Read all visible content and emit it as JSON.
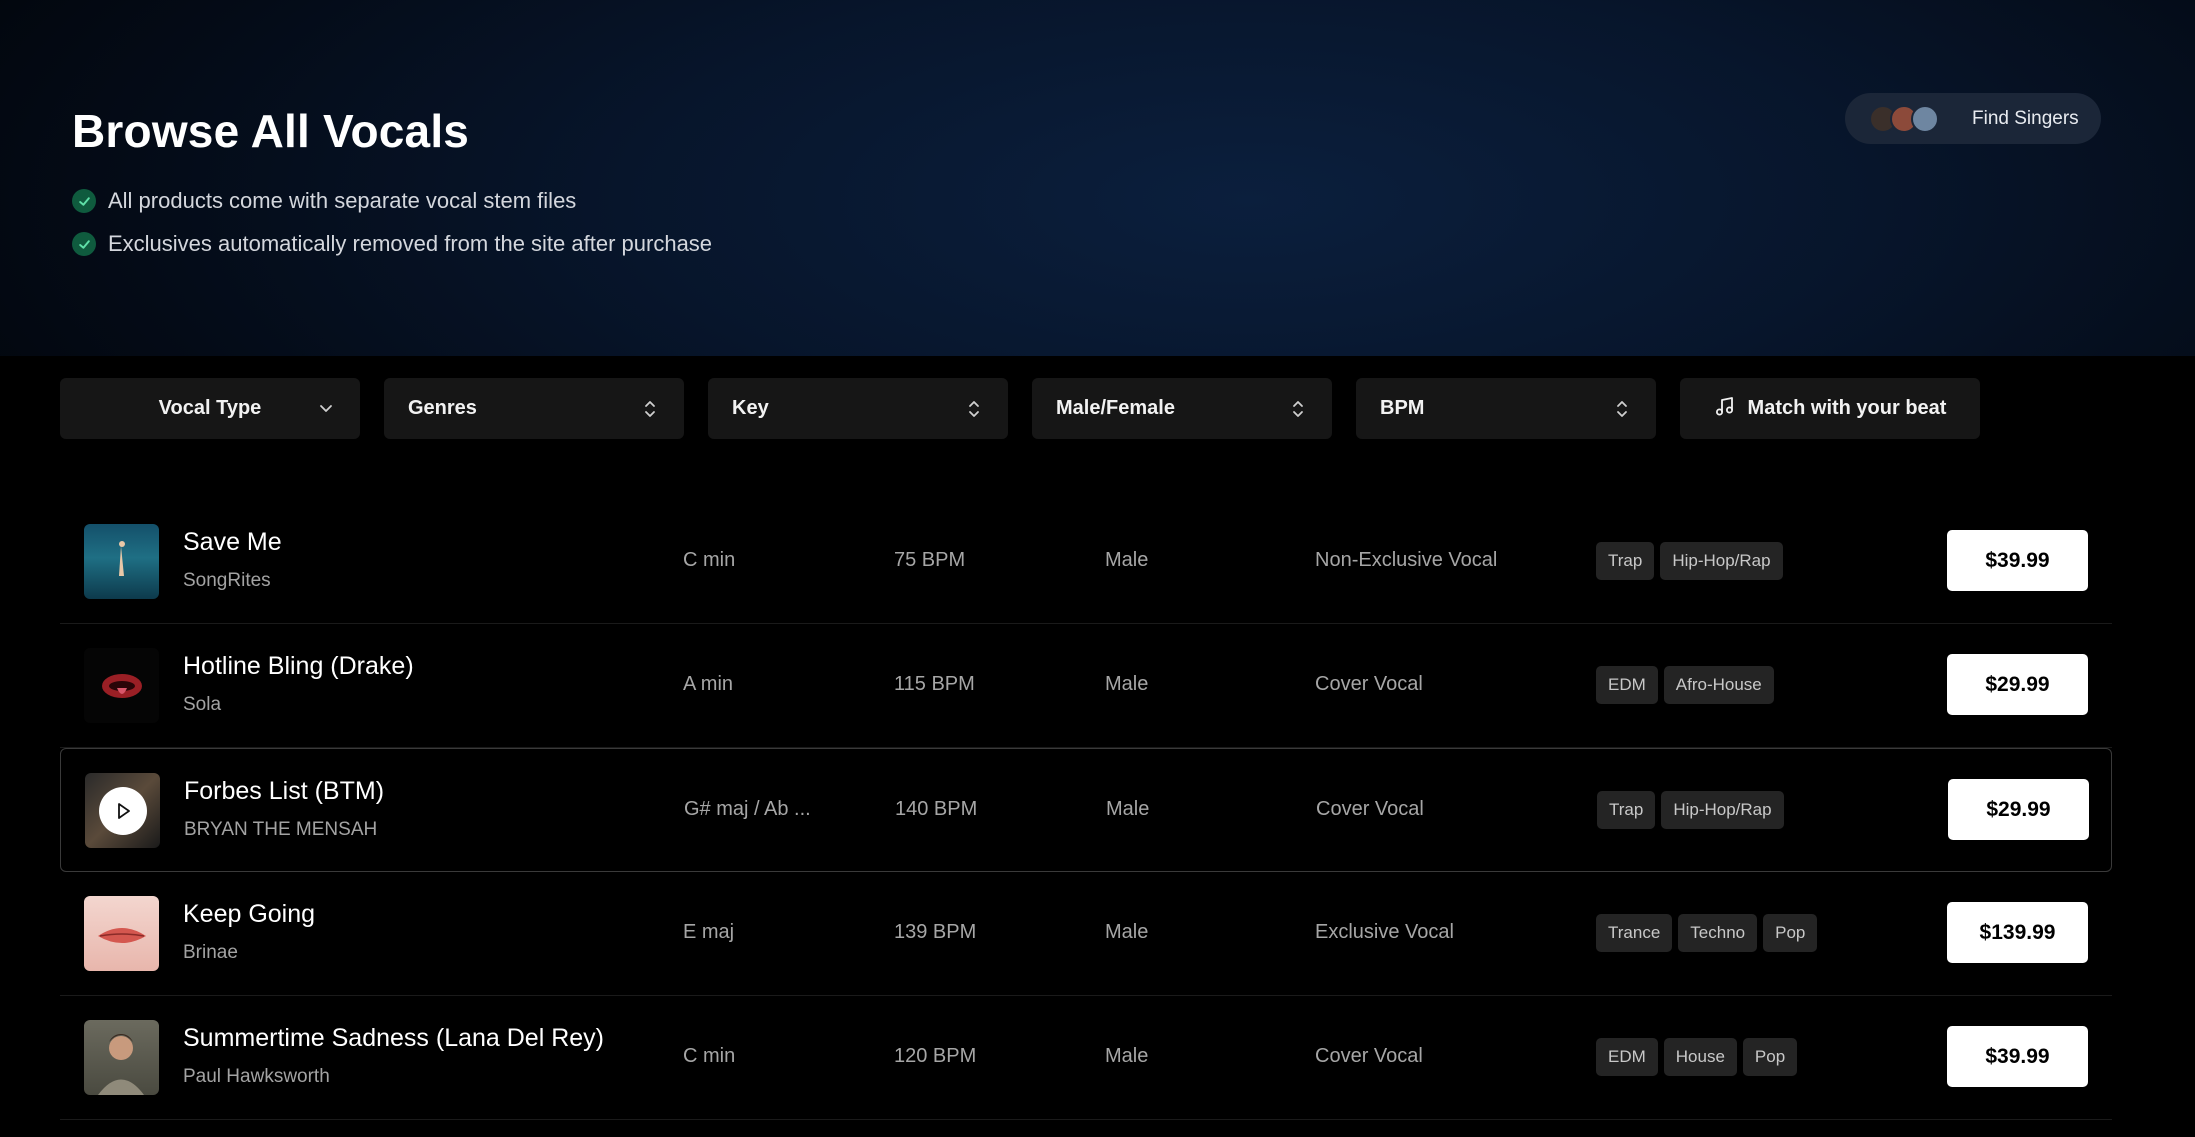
{
  "hero": {
    "title": "Browse All Vocals",
    "features": [
      "All products come with separate vocal stem files",
      "Exclusives automatically removed from the site after purchase"
    ],
    "find_singers_label": "Find Singers"
  },
  "filters": {
    "vocal_type": "Vocal Type",
    "genres": "Genres",
    "key": "Key",
    "gender": "Male/Female",
    "bpm": "BPM",
    "match": "Match with your beat"
  },
  "tracks": [
    {
      "title": "Save Me",
      "artist": "SongRites",
      "key": "C min",
      "bpm": "75 BPM",
      "gender": "Male",
      "type": "Non-Exclusive Vocal",
      "tags": [
        "Trap",
        "Hip-Hop/Rap"
      ],
      "price": "$39.99"
    },
    {
      "title": "Hotline Bling (Drake)",
      "artist": "Sola",
      "key": "A min",
      "bpm": "115 BPM",
      "gender": "Male",
      "type": "Cover Vocal",
      "tags": [
        "EDM",
        "Afro-House"
      ],
      "price": "$29.99"
    },
    {
      "title": "Forbes List (BTM)",
      "artist": "BRYAN THE MENSAH",
      "key": "G# maj / Ab ...",
      "bpm": "140 BPM",
      "gender": "Male",
      "type": "Cover Vocal",
      "tags": [
        "Trap",
        "Hip-Hop/Rap"
      ],
      "price": "$29.99"
    },
    {
      "title": "Keep Going",
      "artist": "Brinae",
      "key": "E maj",
      "bpm": "139 BPM",
      "gender": "Male",
      "type": "Exclusive Vocal",
      "tags": [
        "Trance",
        "Techno",
        "Pop"
      ],
      "price": "$139.99"
    },
    {
      "title": "Summertime Sadness (Lana Del Rey)",
      "artist": "Paul Hawksworth",
      "key": "C min",
      "bpm": "120 BPM",
      "gender": "Male",
      "type": "Cover Vocal",
      "tags": [
        "EDM",
        "House",
        "Pop"
      ],
      "price": "$39.99"
    }
  ],
  "colors": {
    "accent_check": "#0f5b3e",
    "price_bg": "#ffffff",
    "tag_bg": "#242424"
  },
  "icons": {
    "check": "check-icon",
    "chevron": "chevron-down-icon",
    "sort": "sort-arrows-icon",
    "note": "music-note-icon",
    "play": "play-icon"
  }
}
